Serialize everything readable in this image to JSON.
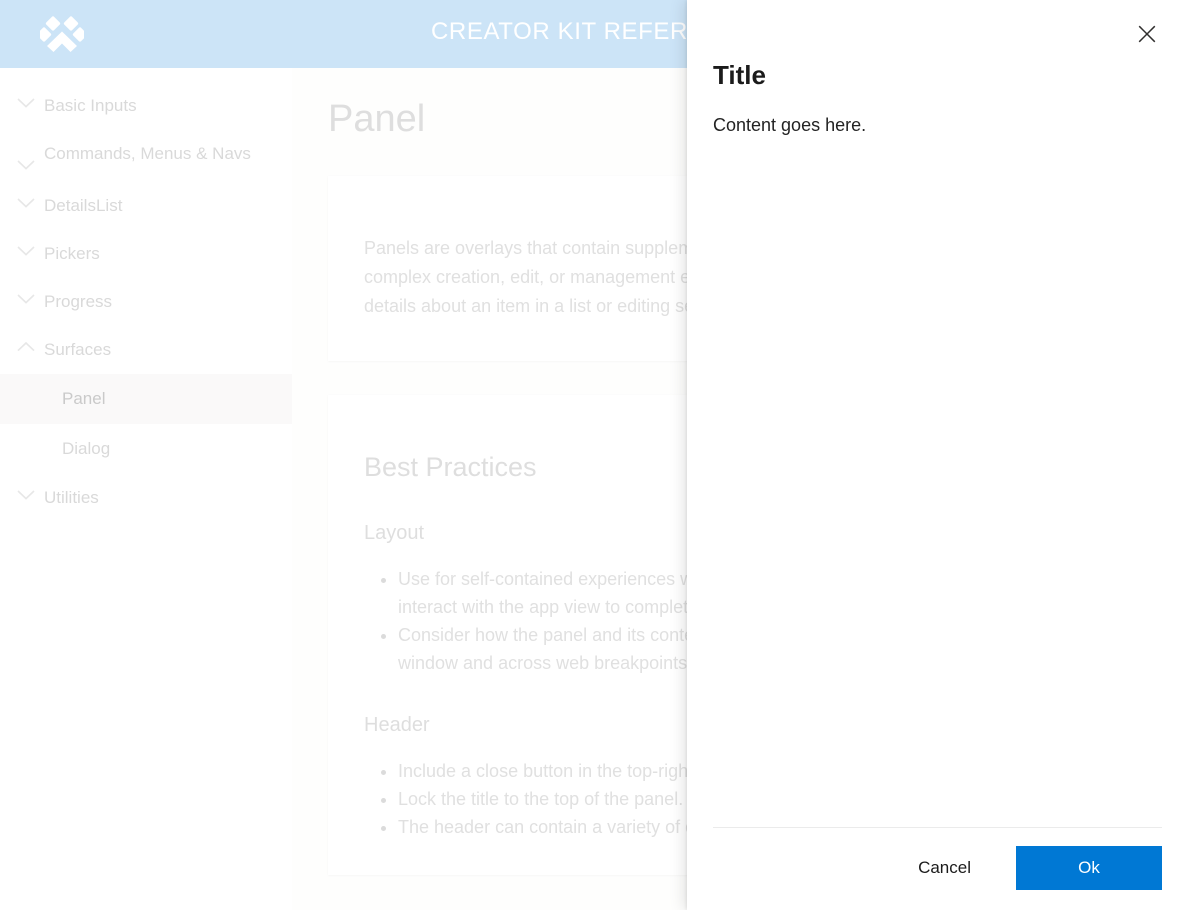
{
  "header": {
    "title": "CREATOR KIT REFERENCE",
    "logo_icon": "diamond-crown-logo-icon",
    "background_color": "#a2cdf0"
  },
  "sidebar": {
    "groups": [
      {
        "label": "Basic Inputs",
        "icon": "chevron-down-icon",
        "expanded": false,
        "children": []
      },
      {
        "label": "Commands, Menus & Navs",
        "icon": "chevron-down-icon",
        "expanded": false,
        "children": []
      },
      {
        "label": "DetailsList",
        "icon": "chevron-down-icon",
        "expanded": false,
        "children": []
      },
      {
        "label": "Pickers",
        "icon": "chevron-down-icon",
        "expanded": false,
        "children": []
      },
      {
        "label": "Progress",
        "icon": "chevron-down-icon",
        "expanded": false,
        "children": []
      },
      {
        "label": "Surfaces",
        "icon": "chevron-up-icon",
        "expanded": true,
        "children": [
          {
            "label": "Panel",
            "selected": true
          },
          {
            "label": "Dialog",
            "selected": false
          }
        ]
      },
      {
        "label": "Utilities",
        "icon": "chevron-down-icon",
        "expanded": false,
        "children": []
      }
    ]
  },
  "content": {
    "page_title": "Panel",
    "description_card": {
      "text": "Panels are overlays that contain supplementary content and are used for complex creation, edit, or management experiences. For example, viewing details about an item in a list or editing settings."
    },
    "best_practices_card": {
      "heading": "Best Practices",
      "sections": [
        {
          "subheading": "Layout",
          "bullets": [
            "Use for self-contained experiences where the user does not need to interact with the app view to complete the task.",
            "Consider how the panel and its content will scale when resizing the window and across web breakpoints."
          ]
        },
        {
          "subheading": "Header",
          "bullets": [
            "Include a close button in the top-right corner of the panel.",
            "Lock the title to the top of the panel.",
            "The header can contain a variety of components."
          ]
        }
      ]
    }
  },
  "panel": {
    "title": "Title",
    "content_text": "Content goes here.",
    "close_icon": "close-icon",
    "footer": {
      "cancel_label": "Cancel",
      "ok_label": "Ok",
      "primary_color": "#0078d4"
    }
  }
}
